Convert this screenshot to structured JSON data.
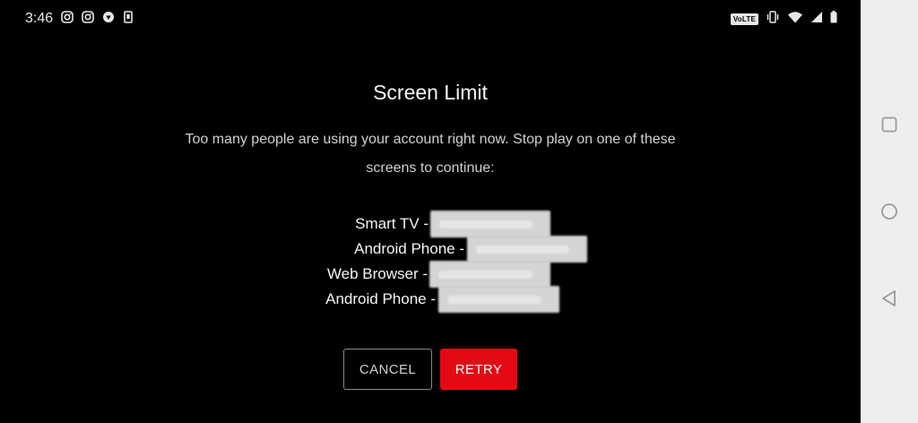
{
  "status_bar": {
    "time": "3:46",
    "left_icons": [
      "instagram-icon",
      "instagram-icon",
      "vpn-icon",
      "sim-card-icon"
    ],
    "volte_label": "VoLTE",
    "right_icons": [
      "vibrate-icon",
      "wifi-icon",
      "cell-signal-icon",
      "battery-icon"
    ]
  },
  "dialog": {
    "title": "Screen Limit",
    "message": "Too many people are using your account right now. Stop play on one of these screens to continue:",
    "devices": [
      {
        "label": "Smart TV -"
      },
      {
        "label": "Android Phone -"
      },
      {
        "label": "Web Browser -"
      },
      {
        "label": "Android Phone -"
      }
    ],
    "cancel_label": "CANCEL",
    "retry_label": "RETRY"
  },
  "colors": {
    "accent_red": "#e50914",
    "background": "#000000",
    "nav_bar": "#eeeeee"
  },
  "nav_bar": {
    "items": [
      "recents-square-icon",
      "home-circle-icon",
      "back-triangle-icon"
    ]
  }
}
